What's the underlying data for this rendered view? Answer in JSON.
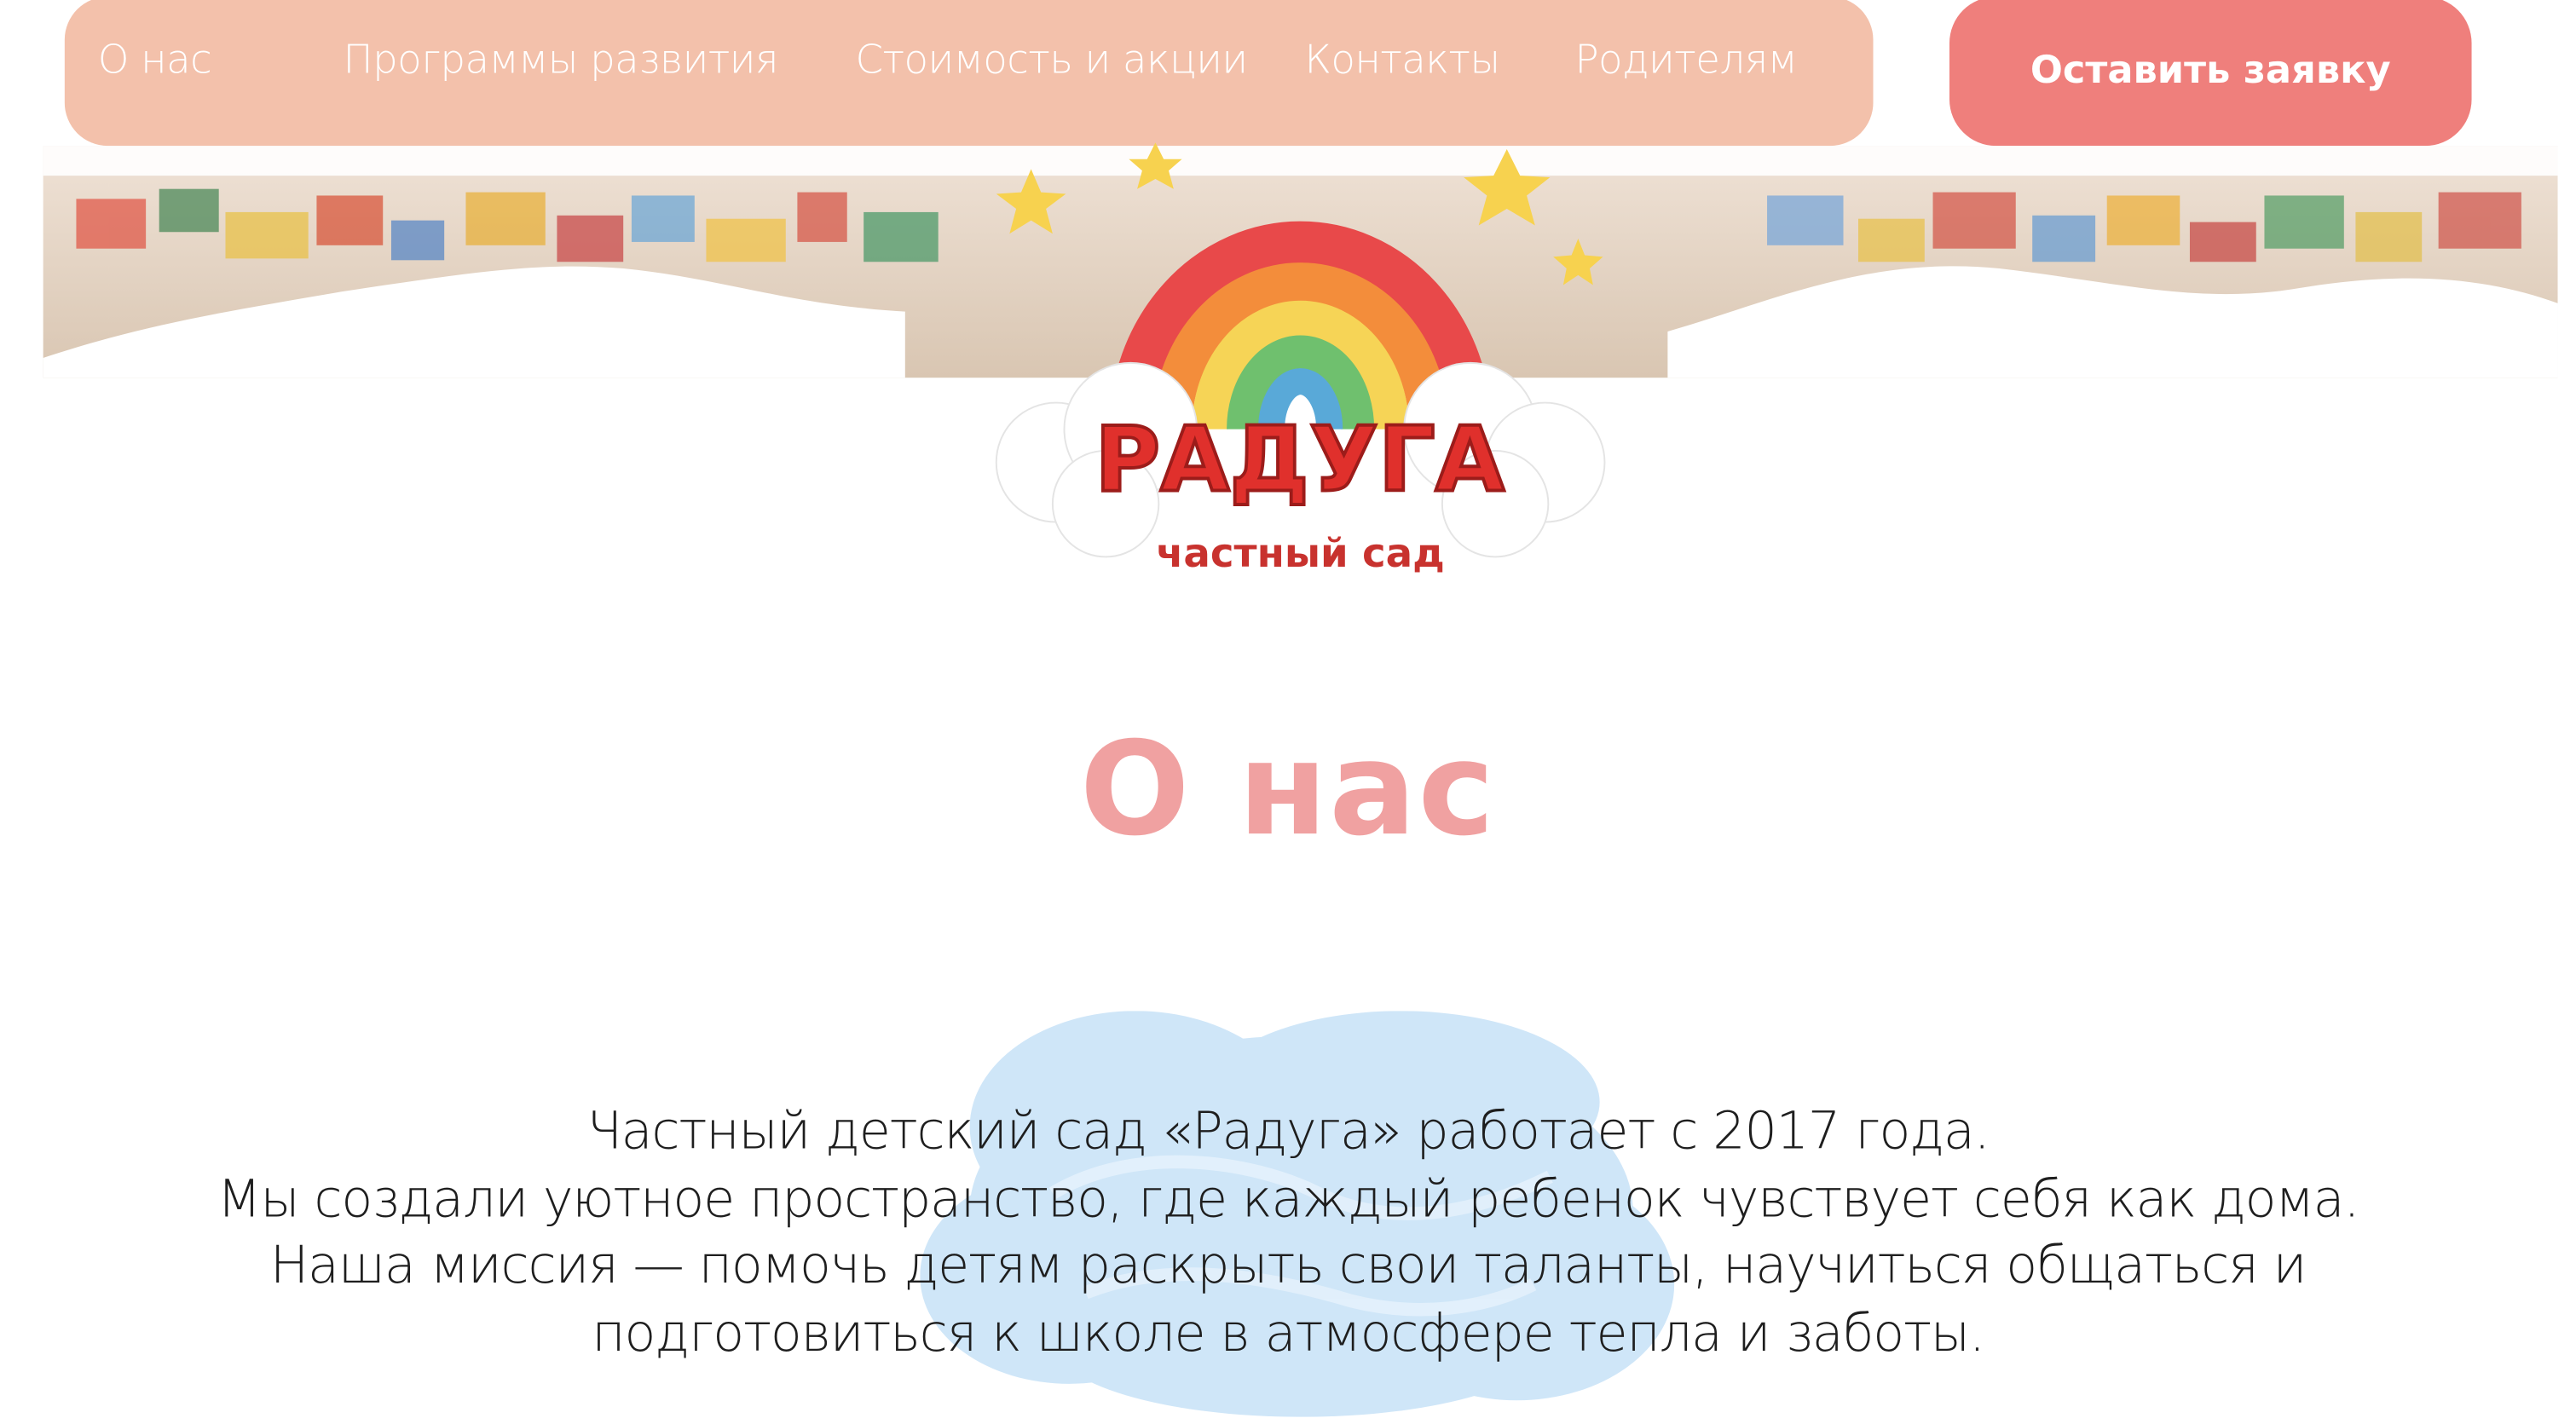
{
  "nav": {
    "items": [
      "О нас",
      "Программы развития",
      "Стоимость и акции",
      "Контакты",
      "Родителям"
    ],
    "cta_label": "Оставить заявку"
  },
  "logo": {
    "title": "РАДУГА",
    "subtitle": "частный сад"
  },
  "about": {
    "heading": "О нас",
    "lines": [
      "Частный детский сад «Радуга» работает с 2017 года.",
      "Мы создали уютное пространство, где каждый ребенок чувствует себя как дома.",
      "Наша миссия — помочь детям раскрыть свои таланты, научиться общаться и",
      "подготовиться к школе в атмосфере тепла и заботы."
    ]
  },
  "colors": {
    "nav_bg": "#f3c1ab",
    "cta_bg": "#ef7f7c",
    "heading": "#f0a1a1",
    "text": "#1e1e1e"
  }
}
